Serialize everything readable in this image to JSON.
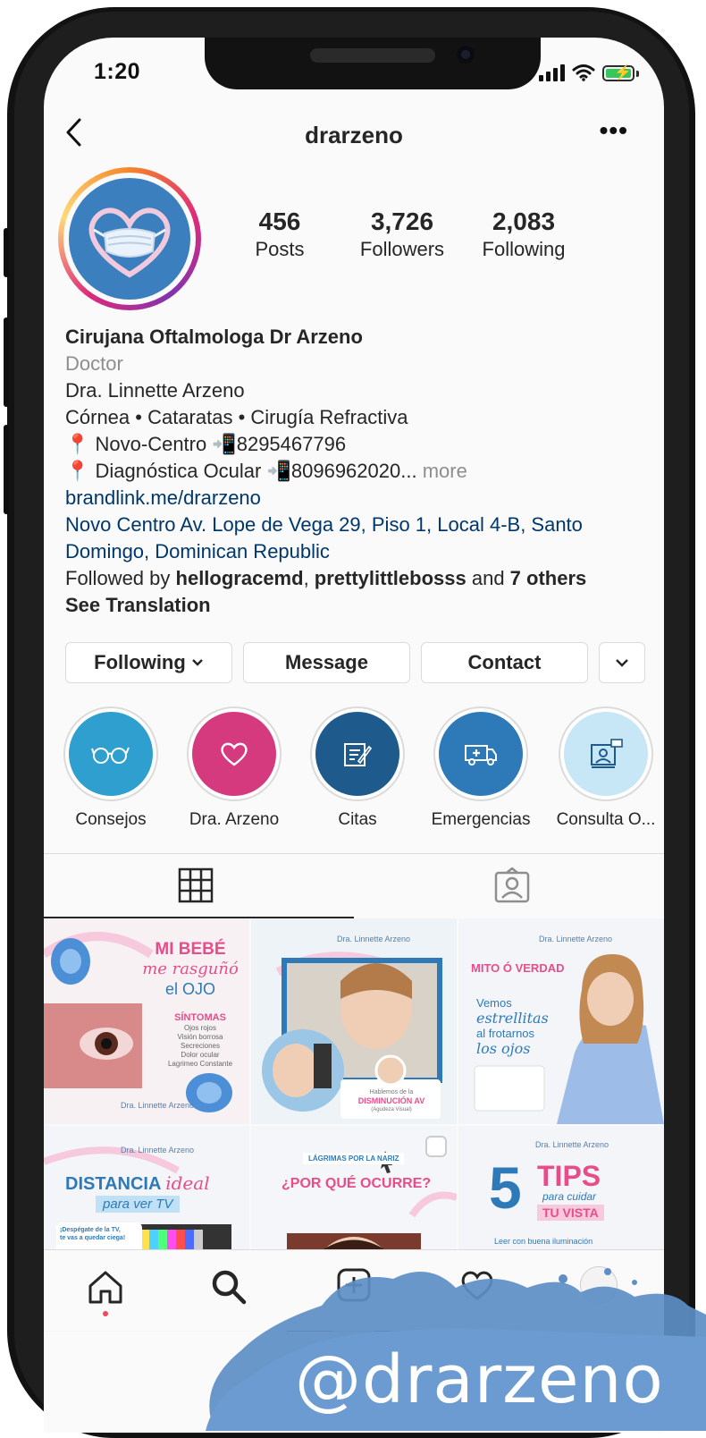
{
  "status_bar": {
    "time": "1:20"
  },
  "header": {
    "username": "drarzeno"
  },
  "profile": {
    "stats": [
      {
        "value": "456",
        "label": "Posts"
      },
      {
        "value": "3,726",
        "label": "Followers"
      },
      {
        "value": "2,083",
        "label": "Following"
      }
    ],
    "display_name": "Cirujana Oftalmologa Dr Arzeno",
    "category": "Doctor",
    "bio_lines": [
      "Dra. Linnette Arzeno",
      "Córnea • Cataratas • Cirugía Refractiva",
      "📍 Novo-Centro 📲8295467796",
      "📍 Diagnóstica Ocular 📲8096962020..."
    ],
    "more_label": "more",
    "website": "brandlink.me/drarzeno",
    "address": "Novo Centro Av. Lope de Vega 29, Piso 1, Local 4-B, Santo Domingo, Dominican Republic",
    "followed_by": {
      "prefix": "Followed by ",
      "user1": "hellogracemd",
      "sep": ", ",
      "user2": "prettylittlebosss",
      "and": " and ",
      "others": "7 others"
    },
    "see_translation": "See Translation"
  },
  "actions": {
    "following": "Following",
    "message": "Message",
    "contact": "Contact"
  },
  "highlights": [
    {
      "label": "Consejos",
      "color": "#2e9fcf",
      "icon": "glasses-icon"
    },
    {
      "label": "Dra. Arzeno",
      "color": "#d63a7e",
      "icon": "heart-icon"
    },
    {
      "label": "Citas",
      "color": "#1e5a8c",
      "icon": "clipboard-icon"
    },
    {
      "label": "Emergencias",
      "color": "#2e7ab8",
      "icon": "ambulance-icon"
    },
    {
      "label": "Consulta O...",
      "color": "#c7e6f6",
      "icon": "video-consult-icon"
    }
  ],
  "posts": [
    {
      "lines": [
        "MI BEBÉ",
        "me rasguñó",
        "el OJO",
        "SÍNTOMAS",
        "Ojos rojos",
        "Visión borrosa",
        "Secreciones",
        "Dolor ocular",
        "Lagrimeo Constante"
      ],
      "brand": "Dra. Linnette Arzeno"
    },
    {
      "lines": [
        "Hablemos de la",
        "DISMINUCIÓN AV",
        "(Agudeza Visual)"
      ],
      "brand": "Dra. Linnette Arzeno"
    },
    {
      "lines": [
        "MITO Ó VERDAD",
        "Vemos",
        "estrellitas",
        "al frotarnos",
        "los ojos"
      ],
      "brand": "Dra. Linnette Arzeno"
    },
    {
      "lines": [
        "DISTANCIA",
        "ideal",
        "para ver TV",
        "¡Despégate de la TV,",
        "te vas a quedar ciega!"
      ],
      "brand": "Dra. Linnette Arzeno"
    },
    {
      "lines": [
        "LÁGRIMAS POR LA NARIZ",
        "¿POR QUÉ OCURRE?"
      ],
      "brand": ""
    },
    {
      "lines": [
        "5",
        "TIPS",
        "para cuidar",
        "TU VISTA",
        "Leer con buena iluminación"
      ],
      "brand": "Dra. Linnette Arzeno"
    }
  ],
  "watermark": "@drarzeno",
  "colors": {
    "link": "#00376b",
    "muted": "#8e8e8e",
    "text": "#262626",
    "brand_pink": "#e84d8a",
    "brand_blue": "#2e7ab8"
  }
}
